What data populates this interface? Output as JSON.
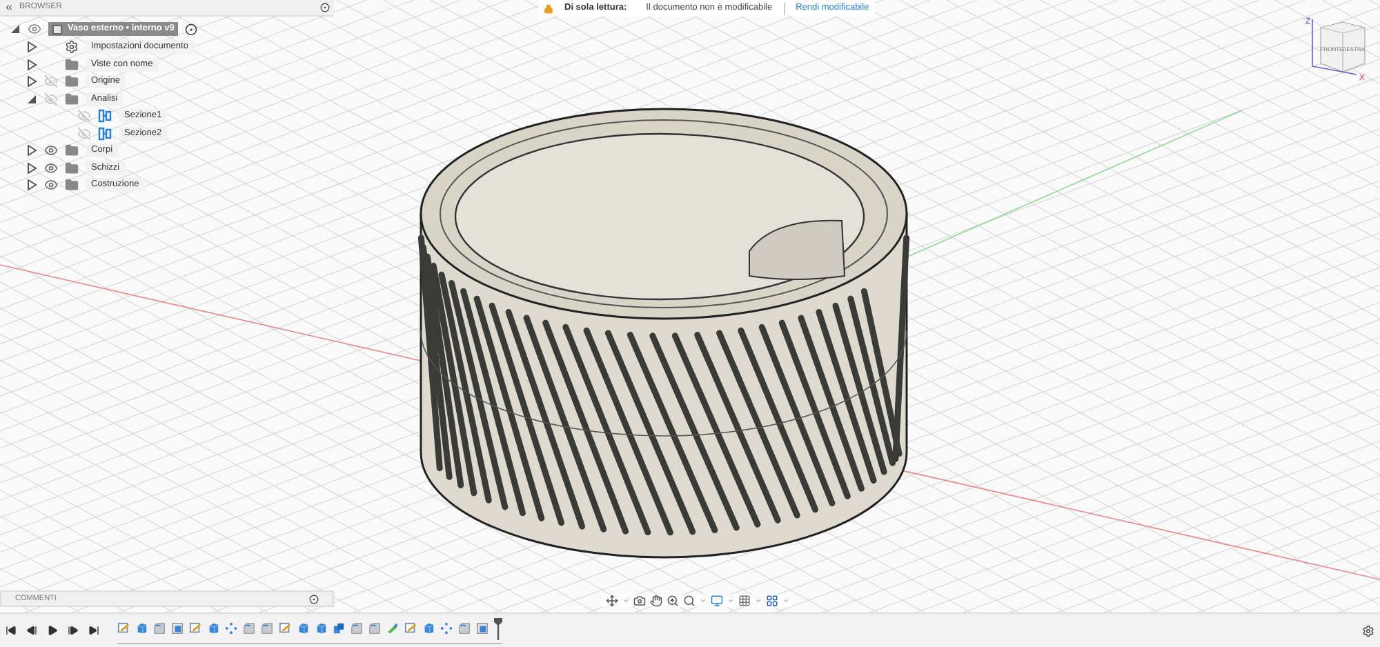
{
  "browser": {
    "title": "BROWSER",
    "root": {
      "label": "Vaso esterno • interno v9",
      "expanded": true
    },
    "items": [
      {
        "kind": "settings",
        "label": "Impostazioni documento",
        "expanded": false
      },
      {
        "kind": "views",
        "label": "Viste con nome",
        "expanded": false
      },
      {
        "kind": "folder",
        "label": "Origine",
        "expanded": false,
        "visible": false
      },
      {
        "kind": "folder",
        "label": "Analisi",
        "expanded": true,
        "visible": false,
        "children": [
          {
            "kind": "section",
            "label": "Sezione1",
            "visible": false
          },
          {
            "kind": "section",
            "label": "Sezione2",
            "visible": false
          }
        ]
      },
      {
        "kind": "folder",
        "label": "Corpi",
        "expanded": false,
        "visible": true
      },
      {
        "kind": "folder",
        "label": "Schizzi",
        "expanded": false,
        "visible": true
      },
      {
        "kind": "folder",
        "label": "Costruzione",
        "expanded": false,
        "visible": true
      }
    ]
  },
  "readonly_banner": {
    "label": "Di sola lettura:",
    "message": "Il documento non è modificabile",
    "action": "Rendi modificabile"
  },
  "viewcube": {
    "front": "FRONTE",
    "right": "DESTRA",
    "axis_up": "Z",
    "axis_side": "X"
  },
  "comments": {
    "title": "COMMENTI"
  },
  "timeline": {
    "features": [
      {
        "kind": "sketch"
      },
      {
        "kind": "extrude"
      },
      {
        "kind": "fillet"
      },
      {
        "kind": "section"
      },
      {
        "kind": "sketch"
      },
      {
        "kind": "extrude"
      },
      {
        "kind": "pattern"
      },
      {
        "kind": "fillet"
      },
      {
        "kind": "fillet"
      },
      {
        "kind": "sketch"
      },
      {
        "kind": "extrude"
      },
      {
        "kind": "extrude"
      },
      {
        "kind": "combine"
      },
      {
        "kind": "fillet"
      },
      {
        "kind": "fillet"
      },
      {
        "kind": "paint"
      },
      {
        "kind": "sketch"
      },
      {
        "kind": "extrude"
      },
      {
        "kind": "pattern"
      },
      {
        "kind": "fillet"
      },
      {
        "kind": "section"
      }
    ]
  }
}
